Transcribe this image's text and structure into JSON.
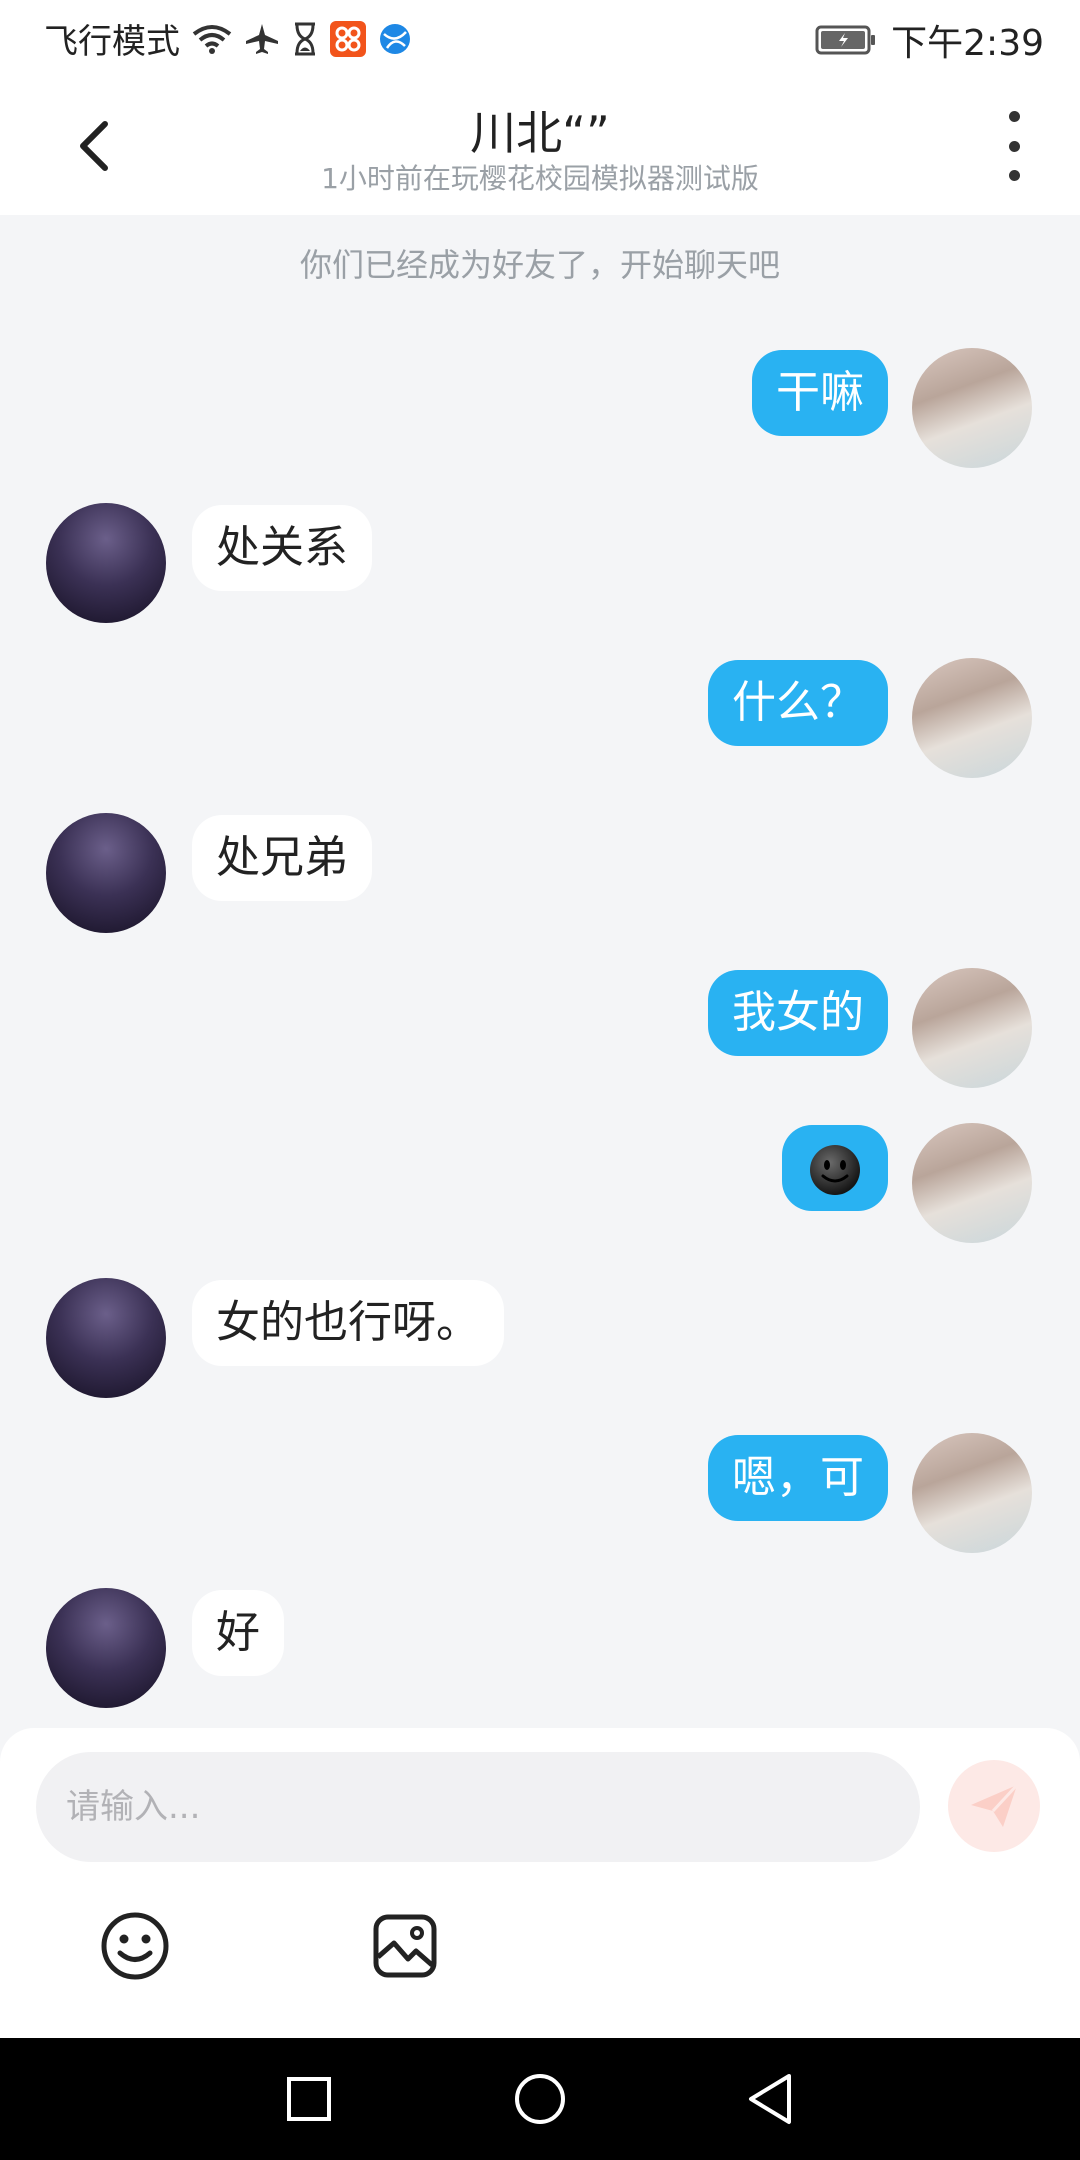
{
  "status_bar": {
    "airplane_mode": "飞行模式",
    "time": "下午2:39",
    "icons": [
      "wifi-icon",
      "airplane-icon",
      "hourglass-icon",
      "app-notification-icon",
      "browser-icon",
      "battery-icon"
    ]
  },
  "header": {
    "title": "川北“”",
    "subtitle": "1小时前在玩樱花校园模拟器测试版",
    "back_icon": "back-arrow-icon",
    "more_icon": "more-vertical-icon"
  },
  "system_message": "你们已经成为好友了，开始聊天吧",
  "messages": [
    {
      "from": "me",
      "text": "干嘛"
    },
    {
      "from": "other",
      "text": "处关系"
    },
    {
      "from": "me",
      "text": "什么？"
    },
    {
      "from": "other",
      "text": "处兄弟"
    },
    {
      "from": "me",
      "text": "我女的"
    },
    {
      "from": "me",
      "emoji": "smiling-face-emoji"
    },
    {
      "from": "other",
      "text": "女的也行呀。"
    },
    {
      "from": "me",
      "text": "嗯，可"
    },
    {
      "from": "other",
      "text": "好"
    }
  ],
  "input": {
    "placeholder": "请输入...",
    "value": ""
  },
  "toolbar": {
    "send_icon": "send-icon",
    "emoji_icon": "emoji-icon",
    "image_icon": "image-icon"
  },
  "colors": {
    "my_bubble": "#29b2f2",
    "other_bubble": "#ffffff",
    "chat_background": "#f4f5f7",
    "send_button": "#fde9e6"
  },
  "nav_bar": [
    "recent-apps-icon",
    "home-icon",
    "back-nav-icon"
  ]
}
